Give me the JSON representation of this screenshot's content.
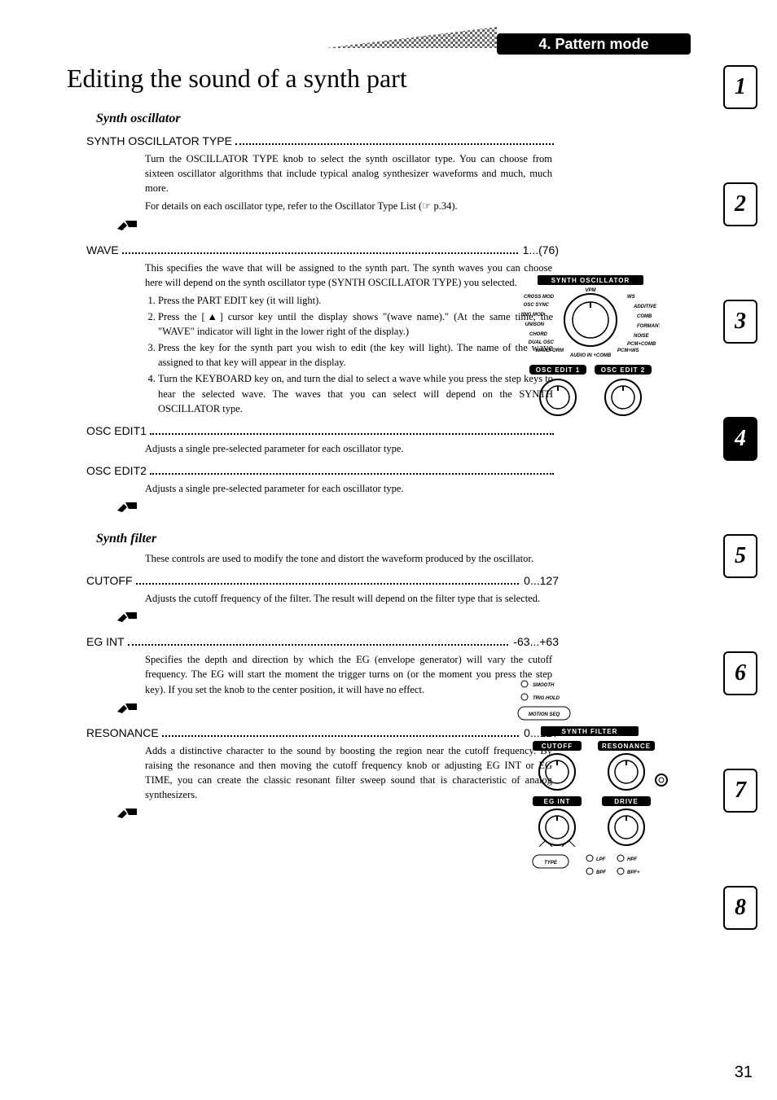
{
  "breadcrumb": "4. Pattern mode",
  "page_number": "31",
  "side_tabs": [
    {
      "label": "1",
      "active": false
    },
    {
      "label": "2",
      "active": false
    },
    {
      "label": "3",
      "active": false
    },
    {
      "label": "4",
      "active": true
    },
    {
      "label": "5",
      "active": false
    },
    {
      "label": "6",
      "active": false
    },
    {
      "label": "7",
      "active": false
    },
    {
      "label": "8",
      "active": false
    }
  ],
  "title": "Editing the sound of a synth part",
  "sections": {
    "osc": {
      "heading": "Synth oscillator",
      "type": {
        "title": "SYNTH OSCILLATOR TYPE",
        "value": "",
        "body": "Turn the OSCILLATOR TYPE knob to select the synth oscillator type. You can choose from sixteen oscillator algorithms that include typical analog synthesizer waveforms and much, much more.",
        "body2": "For details on each oscillator type, refer to the Oscillator Type List (☞ p.34)."
      },
      "wave": {
        "title": "WAVE",
        "value": "1...(76)",
        "body": "This specifies the wave that will be assigned to the synth part. The synth waves you can choose here will depend on the synth oscillator type (SYNTH OSCILLATOR TYPE) you selected.",
        "steps": [
          "Press the PART EDIT key (it will light).",
          "Press the [▲] cursor key until the display shows \"(wave name).\" (At the same time, the \"WAVE\" indicator will light in the lower right of the display.)",
          "Press the key for the synth part you wish to edit (the key will light). The name of the wave assigned to that key will appear in the display.",
          "Turn the KEYBOARD key on, and turn the dial to select a wave while you press the step keys to hear the selected wave. The waves that you can select will depend on the SYNTH OSCILLATOR type."
        ]
      },
      "edit1": {
        "title": "OSC EDIT1",
        "value": "",
        "body": "Adjusts a single pre-selected parameter for each oscillator type."
      },
      "edit2": {
        "title": "OSC EDIT2",
        "value": "",
        "body": "Adjusts a single pre-selected parameter for each oscillator type."
      }
    },
    "filter": {
      "heading": "Synth filter",
      "intro": "These controls are used to modify the tone and distort the waveform produced by the oscillator.",
      "cutoff": {
        "title": "CUTOFF",
        "value": "0...127",
        "body": "Adjusts the cutoff frequency of the filter. The result will depend on the filter type that is selected."
      },
      "egint": {
        "title": "EG INT",
        "value": "-63...+63",
        "body": "Specifies the depth and direction by which the EG (envelope generator) will vary the cutoff frequency. The EG will start the moment the trigger turns on (or the moment you press the step key). If you set the knob to the center position, it will have no effect."
      },
      "resonance": {
        "title": "RESONANCE",
        "value": "0...127",
        "body": "Adds a distinctive character to the sound by boosting the region near the cutoff frequency. By raising the resonance and then moving the cutoff frequency knob or adjusting EG INT or EG TIME, you can create the classic resonant filter sweep sound that is characteristic of analog synthesizers."
      }
    }
  },
  "panel_osc": {
    "title": "SYNTH OSCILLATOR",
    "ring": [
      "CROSS MOD",
      "OSC SYNC",
      "RING MOD",
      "UNISON",
      "CHORD",
      "DUAL OSC",
      "WAVEFORM",
      "AUDIO IN +COMB",
      "VPM",
      "WS",
      "ADDITIVE",
      "COMB",
      "FORMANT",
      "NOISE",
      "PCM+COMB",
      "PCM+WS"
    ],
    "knob1": "OSC EDIT 1",
    "knob2": "OSC EDIT 2"
  },
  "panel_filter": {
    "opts": [
      "SMOOTH",
      "TRIG HOLD"
    ],
    "btn": "MOTION SEQ",
    "title": "SYNTH FILTER",
    "k1": "CUTOFF",
    "k2": "RESONANCE",
    "k3": "EG INT",
    "k4": "DRIVE",
    "type": "TYPE",
    "modes": [
      "LPF",
      "HPF",
      "BPF",
      "BPF+"
    ]
  }
}
